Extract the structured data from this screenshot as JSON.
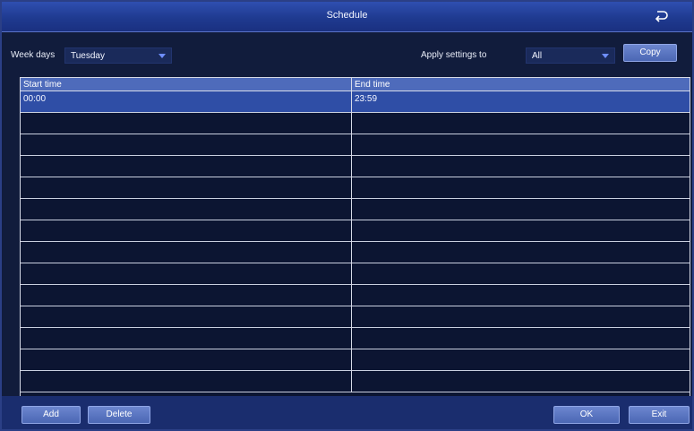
{
  "window": {
    "title": "Schedule"
  },
  "toolbar": {
    "week_days_label": "Week days",
    "week_days_value": "Tuesday",
    "apply_settings_label": "Apply settings to",
    "apply_settings_value": "All",
    "copy_label": "Copy"
  },
  "table": {
    "columns": [
      "Start time",
      "End time"
    ],
    "rows": [
      {
        "start": "00:00",
        "end": "23:59",
        "selected": true
      },
      {
        "start": "",
        "end": ""
      },
      {
        "start": "",
        "end": ""
      },
      {
        "start": "",
        "end": ""
      },
      {
        "start": "",
        "end": ""
      },
      {
        "start": "",
        "end": ""
      },
      {
        "start": "",
        "end": ""
      },
      {
        "start": "",
        "end": ""
      },
      {
        "start": "",
        "end": ""
      },
      {
        "start": "",
        "end": ""
      },
      {
        "start": "",
        "end": ""
      },
      {
        "start": "",
        "end": ""
      },
      {
        "start": "",
        "end": ""
      },
      {
        "start": "",
        "end": ""
      }
    ]
  },
  "footer": {
    "add_label": "Add",
    "delete_label": "Delete",
    "ok_label": "OK",
    "exit_label": "Exit"
  },
  "icons": {
    "back": "return-arrow-icon",
    "dropdown": "triangle-down-icon"
  },
  "colors": {
    "titlebar": "#1f3a90",
    "header_row": "#4e6bbb",
    "selected_row": "#2f4ea6",
    "button": "#5a75c2"
  }
}
